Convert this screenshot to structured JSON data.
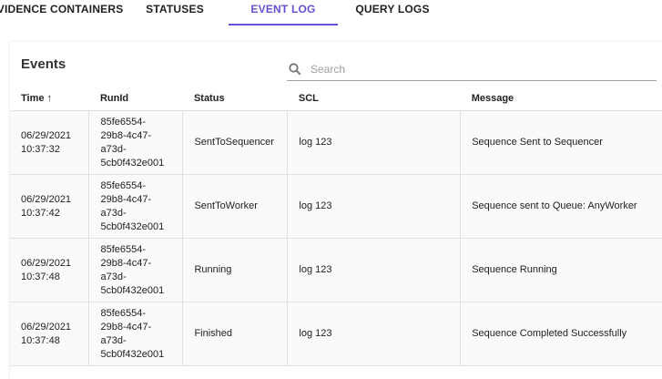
{
  "tabs": [
    {
      "label": "EVIDENCE CONTAINERS",
      "active": false
    },
    {
      "label": "STATUSES",
      "active": false
    },
    {
      "label": "EVENT LOG",
      "active": true
    },
    {
      "label": "QUERY LOGS",
      "active": false
    }
  ],
  "accent_color": "#6a4fd6",
  "panel": {
    "title": "Events",
    "search": {
      "placeholder": "Search",
      "value": "",
      "icon": "search-icon"
    },
    "columns": {
      "time": "Time",
      "time_sort_icon": "↑",
      "runid": "RunId",
      "status": "Status",
      "scl": "SCL",
      "message": "Message"
    },
    "rows": [
      {
        "time": "06/29/2021\n10:37:32",
        "runid": "85fe6554-\n29b8-4c47-\na73d-\n5cb0f432e001",
        "status": "SentToSequencer",
        "scl": "log 123",
        "message": "Sequence Sent to Sequencer"
      },
      {
        "time": "06/29/2021\n10:37:42",
        "runid": "85fe6554-\n29b8-4c47-\na73d-\n5cb0f432e001",
        "status": "SentToWorker",
        "scl": "log 123",
        "message": "Sequence sent to Queue: AnyWorker"
      },
      {
        "time": "06/29/2021\n10:37:48",
        "runid": "85fe6554-\n29b8-4c47-\na73d-\n5cb0f432e001",
        "status": "Running",
        "scl": "log 123",
        "message": "Sequence Running"
      },
      {
        "time": "06/29/2021\n10:37:48",
        "runid": "85fe6554-\n29b8-4c47-\na73d-\n5cb0f432e001",
        "status": "Finished",
        "scl": "log 123",
        "message": "Sequence Completed Successfully"
      }
    ]
  }
}
